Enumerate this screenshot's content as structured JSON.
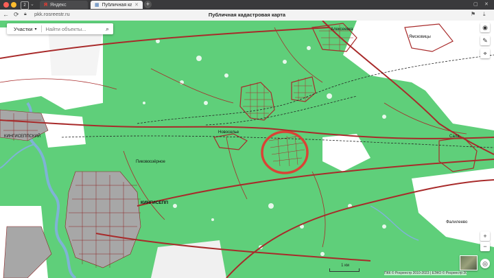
{
  "browser": {
    "tabs": [
      {
        "label": "Яндекс",
        "active": false
      },
      {
        "label": "Публичная кадастровая",
        "active": true
      }
    ],
    "tab_count_badge": "2",
    "url": "pkk.rosreestr.ru",
    "page_title": "Публичная кадастровая карта"
  },
  "search": {
    "mode_label": "Участки",
    "placeholder": "Найти объекты..."
  },
  "map": {
    "labels": {
      "city": "КИНГИСЕПП",
      "west_settlement": "КИНГИСЕППСКИЙ",
      "north_village": "Алексеевка",
      "east_village": "Фалилеево",
      "small_1": "Пиковоозёрное",
      "small_2": "Ямсковицы",
      "small_3": "Новоселье",
      "small_4": "Сала"
    },
    "scale_label": "1 км",
    "attribution": "ПКК © Росреестр 2010-2023 | ЕЭКО © Росреестр 2019-2022",
    "colors": {
      "forest": "#5fcf7a",
      "open_land": "#ffffff",
      "road": "#a82a2a",
      "water": "#7fb3d6",
      "town": "#a7a7a7",
      "marker": "#e8332d"
    }
  },
  "controls": [
    "layers-icon",
    "ruler-icon",
    "info-icon",
    "zoom-in-icon",
    "zoom-out-icon",
    "locate-icon",
    "basemap-thumb"
  ]
}
